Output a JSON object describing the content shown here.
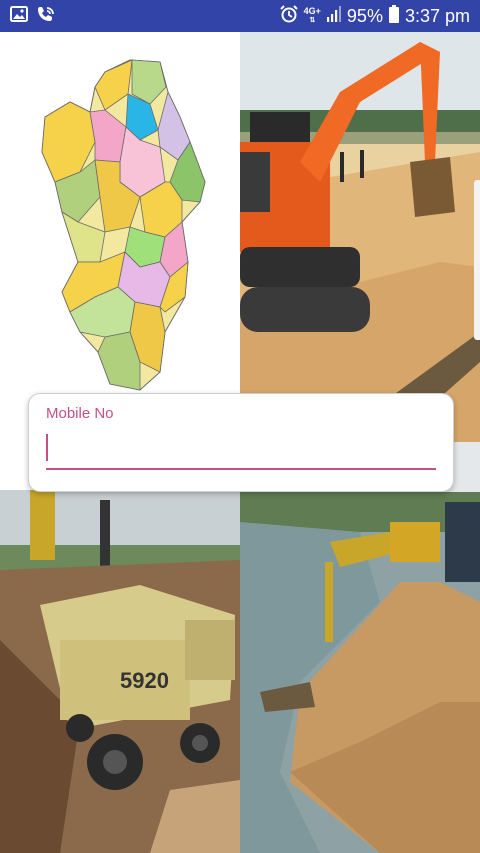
{
  "status_bar": {
    "network_type": "4G+",
    "battery": "95%",
    "time": "3:37 pm",
    "icons": [
      "image-icon",
      "wifi-call-icon",
      "alarm-icon",
      "signal-icon",
      "battery-icon"
    ]
  },
  "colors": {
    "status_bar": "#3344a8",
    "accent": "#c2508b"
  },
  "tiles": [
    {
      "name": "district-map-image"
    },
    {
      "name": "excavator-sand-image"
    },
    {
      "name": "dump-truck-image"
    },
    {
      "name": "river-sand-mining-image"
    }
  ],
  "form": {
    "mobile_label": "Mobile No",
    "mobile_value": ""
  }
}
